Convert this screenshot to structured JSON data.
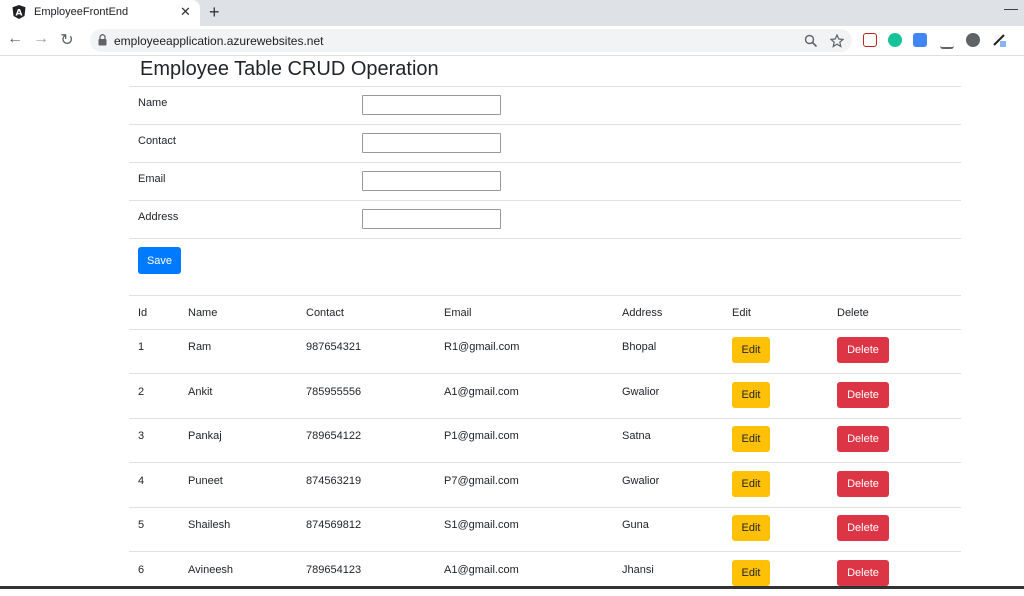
{
  "browser": {
    "tab_title": "EmployeeFrontEnd",
    "tab_close": "✕",
    "new_tab": "+",
    "minimize": "—",
    "url": "employeeapplication.azurewebsites.net",
    "back": "←",
    "forward": "→",
    "reload": "↻"
  },
  "page": {
    "title": "Employee Table CRUD Operation",
    "form": {
      "fields": [
        {
          "label": "Name",
          "value": ""
        },
        {
          "label": "Contact",
          "value": ""
        },
        {
          "label": "Email",
          "value": ""
        },
        {
          "label": "Address",
          "value": ""
        }
      ],
      "save_label": "Save"
    },
    "table": {
      "headers": [
        "Id",
        "Name",
        "Contact",
        "Email",
        "Address",
        "Edit",
        "Delete"
      ],
      "rows": [
        {
          "id": "1",
          "name": "Ram",
          "contact": "987654321",
          "email": "R1@gmail.com",
          "address": "Bhopal"
        },
        {
          "id": "2",
          "name": "Ankit",
          "contact": "785955556",
          "email": "A1@gmail.com",
          "address": "Gwalior"
        },
        {
          "id": "3",
          "name": "Pankaj",
          "contact": "789654122",
          "email": "P1@gmail.com",
          "address": "Satna"
        },
        {
          "id": "4",
          "name": "Puneet",
          "contact": "874563219",
          "email": "P7@gmail.com",
          "address": "Gwalior"
        },
        {
          "id": "5",
          "name": "Shailesh",
          "contact": "874569812",
          "email": "S1@gmail.com",
          "address": "Guna"
        },
        {
          "id": "6",
          "name": "Avineesh",
          "contact": "789654123",
          "email": "A1@gmail.com",
          "address": "Jhansi"
        }
      ],
      "edit_label": "Edit",
      "delete_label": "Delete"
    }
  },
  "colors": {
    "primary": "#007bff",
    "warning": "#ffc107",
    "danger": "#dc3545"
  }
}
